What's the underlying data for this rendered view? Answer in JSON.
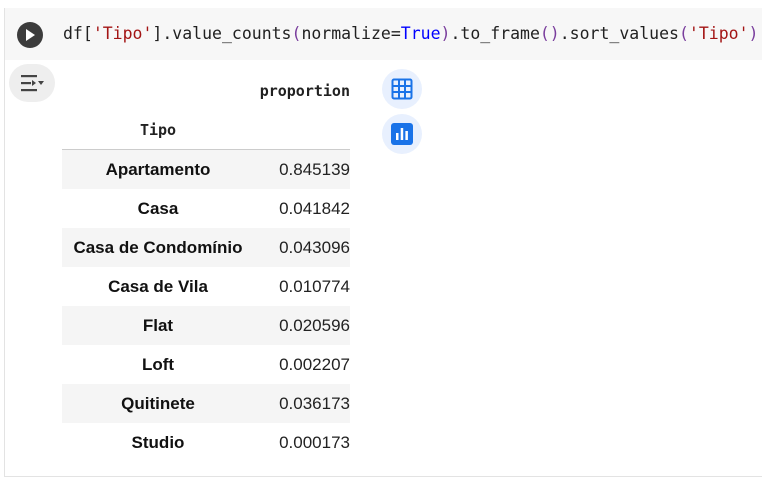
{
  "code": {
    "prefix": "df[",
    "arg_tipo": "'Tipo'",
    "method_chain_1": "].value_counts",
    "open_paren_1": "(",
    "kwarg": "normalize=",
    "true_kw": "True",
    "close_paren_1": ")",
    "method_chain_2": ".to_frame",
    "empty_parens": "()",
    "method_chain_3": ".sort_values",
    "open_paren_2": "(",
    "arg_tipo_2": "'Tipo'",
    "close_paren_2": ")"
  },
  "table": {
    "column_header": "proportion",
    "index_name": "Tipo",
    "rows": [
      {
        "label": "Apartamento",
        "value": "0.845139"
      },
      {
        "label": "Casa",
        "value": "0.041842"
      },
      {
        "label": "Casa de Condomínio",
        "value": "0.043096"
      },
      {
        "label": "Casa de Vila",
        "value": "0.010774"
      },
      {
        "label": "Flat",
        "value": "0.020596"
      },
      {
        "label": "Loft",
        "value": "0.002207"
      },
      {
        "label": "Quitinete",
        "value": "0.036173"
      },
      {
        "label": "Studio",
        "value": "0.000173"
      }
    ]
  },
  "icons": {
    "run": "play-icon",
    "output_toolbar": "output-options-icon",
    "table_view": "table-icon",
    "chart_view": "bar-chart-icon"
  },
  "colors": {
    "string": "#a31515",
    "keyword": "#0000ff",
    "paren": "#7a3e9d",
    "accent_blue": "#1a73e8"
  }
}
